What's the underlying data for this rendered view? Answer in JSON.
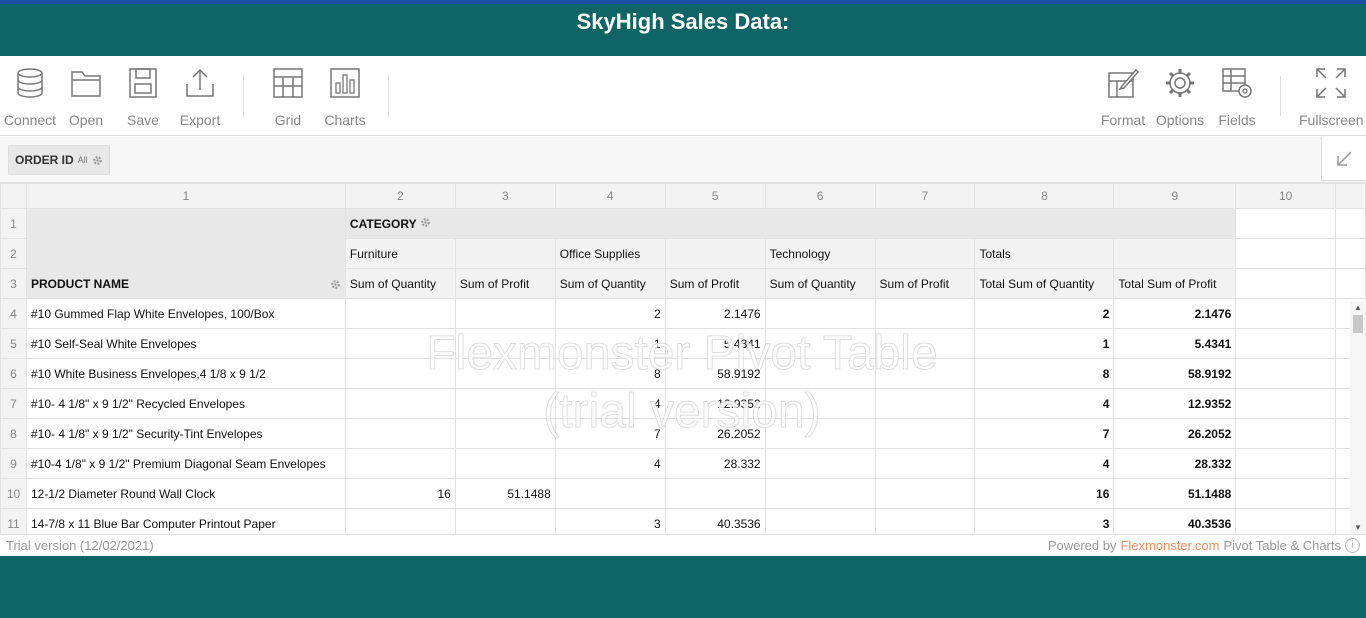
{
  "page_title": "SkyHigh Sales Data:",
  "toolbar": {
    "connect": "Connect",
    "open": "Open",
    "save": "Save",
    "export": "Export",
    "grid": "Grid",
    "charts": "Charts",
    "format": "Format",
    "options": "Options",
    "fields": "Fields",
    "fullscreen": "Fullscreen"
  },
  "filter": {
    "label": "ORDER ID",
    "value": "All"
  },
  "columns": [
    "1",
    "2",
    "3",
    "4",
    "5",
    "6",
    "7",
    "8",
    "9",
    "10"
  ],
  "pivot": {
    "category_label": "CATEGORY",
    "product_label": "PRODUCT NAME",
    "groups": [
      "Furniture",
      "Office Supplies",
      "Technology",
      "Totals"
    ],
    "measures": [
      "Sum of Quantity",
      "Sum of Profit",
      "Sum of Quantity",
      "Sum of Profit",
      "Sum of Quantity",
      "Sum of Profit",
      "Total Sum of Quantity",
      "Total Sum of Profit"
    ],
    "rows": [
      {
        "n": "4",
        "name": "#10 Gummed Flap White Envelopes, 100/Box",
        "fq": "",
        "fp": "",
        "oq": "2",
        "op": "2.1476",
        "tq": "",
        "tp": "",
        "sq": "2",
        "sp": "2.1476"
      },
      {
        "n": "5",
        "name": "#10 Self-Seal White Envelopes",
        "fq": "",
        "fp": "",
        "oq": "1",
        "op": "5.4341",
        "tq": "",
        "tp": "",
        "sq": "1",
        "sp": "5.4341"
      },
      {
        "n": "6",
        "name": "#10 White Business Envelopes,4 1/8 x 9 1/2",
        "fq": "",
        "fp": "",
        "oq": "8",
        "op": "58.9192",
        "tq": "",
        "tp": "",
        "sq": "8",
        "sp": "58.9192"
      },
      {
        "n": "7",
        "name": "#10- 4 1/8\" x 9 1/2\" Recycled Envelopes",
        "fq": "",
        "fp": "",
        "oq": "4",
        "op": "12.9352",
        "tq": "",
        "tp": "",
        "sq": "4",
        "sp": "12.9352"
      },
      {
        "n": "8",
        "name": "#10- 4 1/8\" x 9 1/2\" Security-Tint Envelopes",
        "fq": "",
        "fp": "",
        "oq": "7",
        "op": "26.2052",
        "tq": "",
        "tp": "",
        "sq": "7",
        "sp": "26.2052"
      },
      {
        "n": "9",
        "name": "#10-4 1/8\" x 9 1/2\" Premium Diagonal Seam Envelopes",
        "fq": "",
        "fp": "",
        "oq": "4",
        "op": "28.332",
        "tq": "",
        "tp": "",
        "sq": "4",
        "sp": "28.332"
      },
      {
        "n": "10",
        "name": "12-1/2 Diameter Round Wall Clock",
        "fq": "16",
        "fp": "51.1488",
        "oq": "",
        "op": "",
        "tq": "",
        "tp": "",
        "sq": "16",
        "sp": "51.1488"
      },
      {
        "n": "11",
        "name": "14-7/8 x 11 Blue Bar Computer Printout Paper",
        "fq": "",
        "fp": "",
        "oq": "3",
        "op": "40.3536",
        "tq": "",
        "tp": "",
        "sq": "3",
        "sp": "40.3536"
      }
    ]
  },
  "watermark": {
    "line1": "Flexmonster Pivot Table",
    "line2": "(trial version)"
  },
  "footer": {
    "trial": "Trial version (12/02/2021)",
    "powered": "Powered by",
    "brand": "Flexmonster.com",
    "suffix": "Pivot Table & Charts"
  }
}
